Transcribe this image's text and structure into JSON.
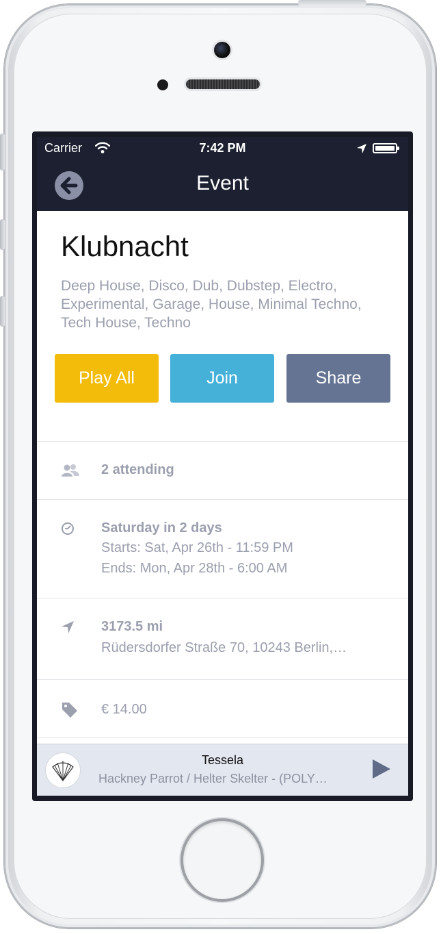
{
  "status_bar": {
    "carrier": "Carrier",
    "time": "7:42 PM"
  },
  "nav": {
    "title": "Event"
  },
  "event": {
    "title": "Klubnacht",
    "genres": "Deep House, Disco, Dub, Dubstep, Electro, Experimental, Garage, House, Minimal Techno, Tech House, Techno"
  },
  "actions": {
    "play_all": "Play All",
    "join": "Join",
    "share": "Share"
  },
  "details": {
    "attending": "2 attending",
    "when": "Saturday in 2 days",
    "starts": "Starts: Sat, Apr 26th - 11:59 PM",
    "ends": "Ends: Mon, Apr 28th - 6:00 AM",
    "distance": "3173.5 mi",
    "address": "Rüdersdorfer Straße 70, 10243 Berlin,…",
    "price": "€ 14.00"
  },
  "player": {
    "artist": "Tessela",
    "track": "Hackney Parrot / Helter Skelter - (POLY…"
  },
  "colors": {
    "nav_bg": "#1c2030",
    "play_all": "#f4bc0a",
    "join": "#45b0d8",
    "share": "#657493",
    "muted_text": "#9b9fae"
  },
  "icons": {
    "back": "back-arrow-icon",
    "attending": "people-icon",
    "time": "clock-icon",
    "location": "location-arrow-icon",
    "price": "tag-icon",
    "play": "play-icon"
  }
}
